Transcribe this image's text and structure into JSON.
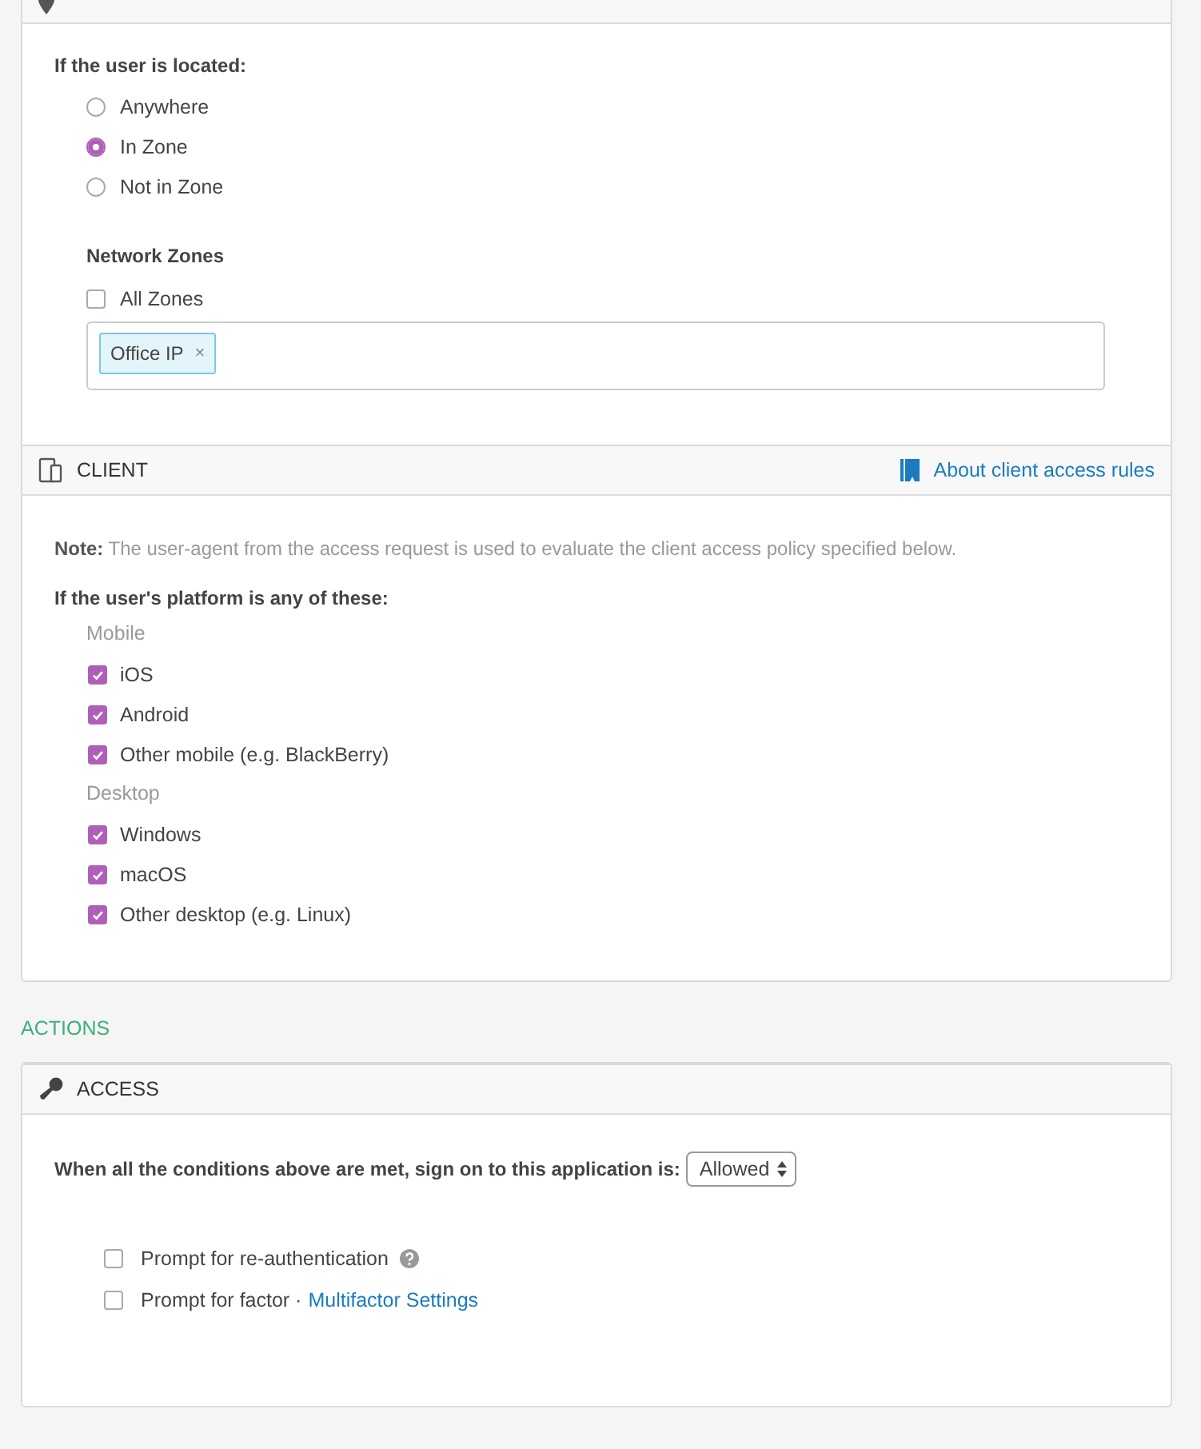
{
  "location": {
    "heading": "If the user is located:",
    "options": [
      {
        "label": "Anywhere",
        "selected": false
      },
      {
        "label": "In Zone",
        "selected": true
      },
      {
        "label": "Not in Zone",
        "selected": false
      }
    ],
    "network_zones": {
      "label": "Network Zones",
      "all_zones": {
        "label": "All Zones",
        "checked": false
      },
      "tags": [
        {
          "label": "Office IP",
          "remove": "×"
        }
      ]
    }
  },
  "client": {
    "title": "CLIENT",
    "help_link": "About client access rules",
    "note": "**Note:** The user-agent from the access request is used to evaluate the client access policy specified below.",
    "platform_heading": "If the user's platform is any of these:",
    "groups": [
      {
        "label": "Mobile",
        "items": [
          {
            "label": "iOS",
            "checked": true
          },
          {
            "label": "Android",
            "checked": true
          },
          {
            "label": "Other mobile (e.g. BlackBerry)",
            "checked": true
          }
        ]
      },
      {
        "label": "Desktop",
        "items": [
          {
            "label": "Windows",
            "checked": true
          },
          {
            "label": "macOS",
            "checked": true
          },
          {
            "label": "Other desktop (e.g. Linux)",
            "checked": true
          }
        ]
      }
    ]
  },
  "actions_heading": "ACTIONS",
  "access": {
    "title": "ACCESS",
    "statement": "When all the conditions above are met, sign on to this application is:",
    "select": {
      "value": "Allowed"
    },
    "options": [
      {
        "label": "Prompt for re-authentication",
        "checked": false,
        "help": true
      },
      {
        "label": "Prompt for factor ·",
        "checked": false,
        "help": false,
        "link": "Multifactor Settings"
      }
    ]
  }
}
